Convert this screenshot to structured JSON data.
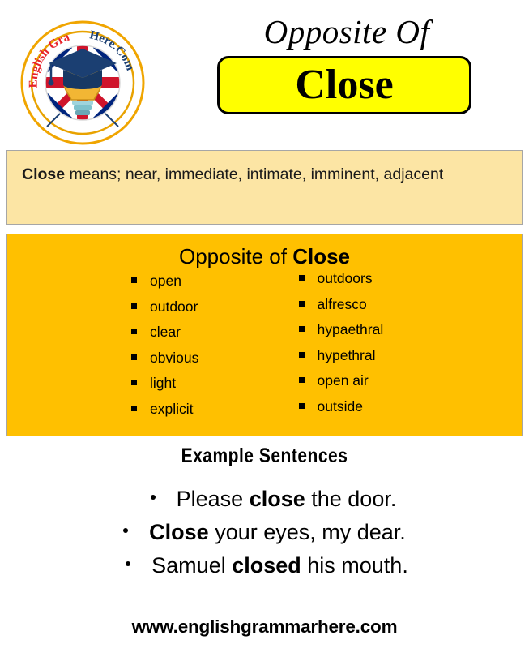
{
  "header": {
    "title": "Opposite Of",
    "word": "Close",
    "logo": {
      "arc_text_left": "English Grammar",
      "arc_text_right": "Here.Com",
      "alt": "english-grammar-here-logo"
    }
  },
  "definition": {
    "term": "Close",
    "text": " means; near, immediate, intimate, imminent, adjacent"
  },
  "opposites": {
    "title_prefix": "Opposite of ",
    "title_word": "Close",
    "left_column": [
      "open",
      "outdoor",
      "clear",
      "obvious",
      "light",
      "explicit"
    ],
    "right_column": [
      "outdoors",
      "alfresco",
      "hypaethral",
      "hypethral",
      "open air",
      "outside"
    ]
  },
  "examples": {
    "title": "Example  Sentences",
    "sentences": [
      {
        "before": "Please ",
        "bold": "close",
        "after": " the door."
      },
      {
        "before": "",
        "bold": "Close",
        "after": " your eyes, my dear."
      },
      {
        "before": "Samuel ",
        "bold": "closed",
        "after": " his mouth."
      }
    ]
  },
  "footer": {
    "url": "www.englishgrammarhere.com"
  },
  "colors": {
    "accent_orange": "#FFC000",
    "cream": "#FCE5A4",
    "highlight_yellow": "#FFFF00",
    "border_gray": "#A6A6A6"
  }
}
